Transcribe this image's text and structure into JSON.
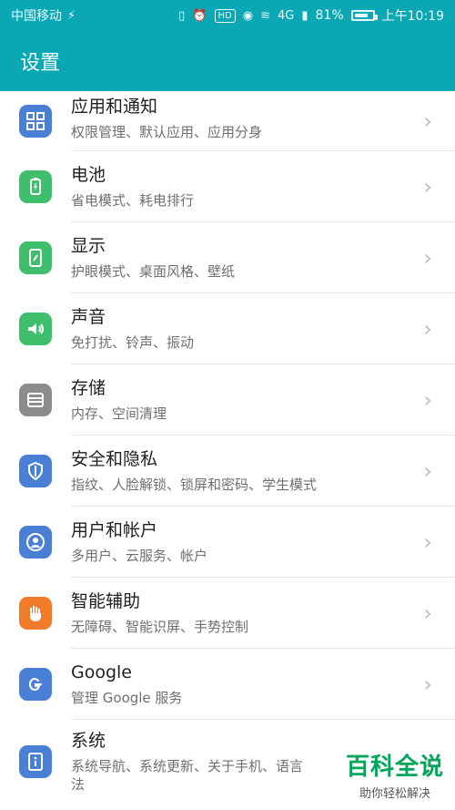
{
  "status_bar": {
    "carrier": "中国移动",
    "wifi_signal_label": "4G",
    "battery_percent": "81%",
    "battery_level": 0.81,
    "time": "上午10:19"
  },
  "appbar": {
    "title": "设置"
  },
  "items": [
    {
      "title": "应用和通知",
      "subtitle": "权限管理、默认应用、应用分身",
      "icon": "apps-icon",
      "color": "#4a7fd6"
    },
    {
      "title": "电池",
      "subtitle": "省电模式、耗电排行",
      "icon": "battery-icon",
      "color": "#3fbf6e"
    },
    {
      "title": "显示",
      "subtitle": "护眼模式、桌面风格、壁纸",
      "icon": "display-icon",
      "color": "#3fbf6e"
    },
    {
      "title": "声音",
      "subtitle": "免打扰、铃声、振动",
      "icon": "sound-icon",
      "color": "#3fbf6e"
    },
    {
      "title": "存储",
      "subtitle": "内存、空间清理",
      "icon": "storage-icon",
      "color": "#8c8c8c"
    },
    {
      "title": "安全和隐私",
      "subtitle": "指纹、人脸解锁、锁屏和密码、学生模式",
      "icon": "shield-icon",
      "color": "#4a7fd6"
    },
    {
      "title": "用户和帐户",
      "subtitle": "多用户、云服务、帐户",
      "icon": "user-icon",
      "color": "#4a7fd6"
    },
    {
      "title": "智能辅助",
      "subtitle": "无障碍、智能识屏、手势控制",
      "icon": "hand-icon",
      "color": "#ef7b2b"
    },
    {
      "title": "Google",
      "subtitle": "管理 Google 服务",
      "icon": "google-icon",
      "color": "#4a7fd6"
    },
    {
      "title": "系统",
      "subtitle": "系统导航、系统更新、关于手机、语言",
      "subtitle_line2": "法",
      "icon": "info-icon",
      "color": "#4a7fd6"
    }
  ],
  "watermark": {
    "main": "百科全说",
    "sub": "助你轻松解决"
  }
}
